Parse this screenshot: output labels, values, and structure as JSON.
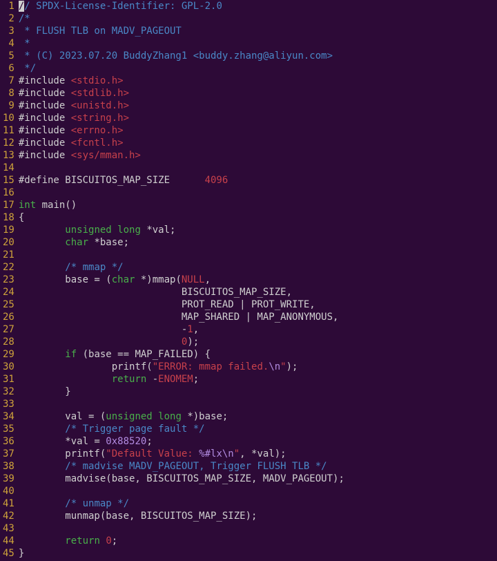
{
  "filename": "main.c",
  "language": "c",
  "lines": [
    {
      "n": 1,
      "tokens": [
        {
          "t": "cursor",
          "v": "/"
        },
        {
          "t": "comment",
          "v": "/ SPDX-License-Identifier: GPL-2.0"
        }
      ]
    },
    {
      "n": 2,
      "tokens": [
        {
          "t": "comment",
          "v": "/*"
        }
      ]
    },
    {
      "n": 3,
      "tokens": [
        {
          "t": "comment",
          "v": " * FLUSH TLB on MADV_PAGEOUT"
        }
      ]
    },
    {
      "n": 4,
      "tokens": [
        {
          "t": "comment",
          "v": " *"
        }
      ]
    },
    {
      "n": 5,
      "tokens": [
        {
          "t": "comment",
          "v": " * (C) 2023.07.20 BuddyZhang1 <buddy.zhang@aliyun.com>"
        }
      ]
    },
    {
      "n": 6,
      "tokens": [
        {
          "t": "comment",
          "v": " */"
        }
      ]
    },
    {
      "n": 7,
      "tokens": [
        {
          "t": "preproc",
          "v": "#include "
        },
        {
          "t": "incfile",
          "v": "<stdio.h>"
        }
      ]
    },
    {
      "n": 8,
      "tokens": [
        {
          "t": "preproc",
          "v": "#include "
        },
        {
          "t": "incfile",
          "v": "<stdlib.h>"
        }
      ]
    },
    {
      "n": 9,
      "tokens": [
        {
          "t": "preproc",
          "v": "#include "
        },
        {
          "t": "incfile",
          "v": "<unistd.h>"
        }
      ]
    },
    {
      "n": 10,
      "tokens": [
        {
          "t": "preproc",
          "v": "#include "
        },
        {
          "t": "incfile",
          "v": "<string.h>"
        }
      ]
    },
    {
      "n": 11,
      "tokens": [
        {
          "t": "preproc",
          "v": "#include "
        },
        {
          "t": "incfile",
          "v": "<errno.h>"
        }
      ]
    },
    {
      "n": 12,
      "tokens": [
        {
          "t": "preproc",
          "v": "#include "
        },
        {
          "t": "incfile",
          "v": "<fcntl.h>"
        }
      ]
    },
    {
      "n": 13,
      "tokens": [
        {
          "t": "preproc",
          "v": "#include "
        },
        {
          "t": "incfile",
          "v": "<sys/mman.h>"
        }
      ]
    },
    {
      "n": 14,
      "tokens": []
    },
    {
      "n": 15,
      "tokens": [
        {
          "t": "preproc",
          "v": "#define BISCUITOS_MAP_SIZE      "
        },
        {
          "t": "number",
          "v": "4096"
        }
      ]
    },
    {
      "n": 16,
      "tokens": []
    },
    {
      "n": 17,
      "tokens": [
        {
          "t": "type",
          "v": "int"
        },
        {
          "t": "ident",
          "v": " main()"
        }
      ]
    },
    {
      "n": 18,
      "tokens": [
        {
          "t": "punct",
          "v": "{"
        }
      ]
    },
    {
      "n": 19,
      "tokens": [
        {
          "t": "ident",
          "v": "        "
        },
        {
          "t": "type",
          "v": "unsigned"
        },
        {
          "t": "ident",
          "v": " "
        },
        {
          "t": "type",
          "v": "long"
        },
        {
          "t": "ident",
          "v": " *val;"
        }
      ]
    },
    {
      "n": 20,
      "tokens": [
        {
          "t": "ident",
          "v": "        "
        },
        {
          "t": "type",
          "v": "char"
        },
        {
          "t": "ident",
          "v": " *base;"
        }
      ]
    },
    {
      "n": 21,
      "tokens": []
    },
    {
      "n": 22,
      "tokens": [
        {
          "t": "ident",
          "v": "        "
        },
        {
          "t": "comment",
          "v": "/* mmap */"
        }
      ]
    },
    {
      "n": 23,
      "tokens": [
        {
          "t": "ident",
          "v": "        base = ("
        },
        {
          "t": "type",
          "v": "char"
        },
        {
          "t": "ident",
          "v": " *)mmap("
        },
        {
          "t": "const",
          "v": "NULL"
        },
        {
          "t": "ident",
          "v": ","
        }
      ]
    },
    {
      "n": 24,
      "tokens": [
        {
          "t": "ident",
          "v": "                            BISCUITOS_MAP_SIZE,"
        }
      ]
    },
    {
      "n": 25,
      "tokens": [
        {
          "t": "ident",
          "v": "                            PROT_READ | PROT_WRITE,"
        }
      ]
    },
    {
      "n": 26,
      "tokens": [
        {
          "t": "ident",
          "v": "                            MAP_SHARED | MAP_ANONYMOUS,"
        }
      ]
    },
    {
      "n": 27,
      "tokens": [
        {
          "t": "ident",
          "v": "                            -"
        },
        {
          "t": "number",
          "v": "1"
        },
        {
          "t": "ident",
          "v": ","
        }
      ]
    },
    {
      "n": 28,
      "tokens": [
        {
          "t": "ident",
          "v": "                            "
        },
        {
          "t": "number",
          "v": "0"
        },
        {
          "t": "ident",
          "v": ");"
        }
      ]
    },
    {
      "n": 29,
      "tokens": [
        {
          "t": "ident",
          "v": "        "
        },
        {
          "t": "keyword",
          "v": "if"
        },
        {
          "t": "ident",
          "v": " (base == MAP_FAILED) {"
        }
      ]
    },
    {
      "n": 30,
      "tokens": [
        {
          "t": "ident",
          "v": "                printf("
        },
        {
          "t": "string",
          "v": "\"ERROR: mmap failed."
        },
        {
          "t": "fmt",
          "v": "\\n"
        },
        {
          "t": "string",
          "v": "\""
        },
        {
          "t": "ident",
          "v": ");"
        }
      ]
    },
    {
      "n": 31,
      "tokens": [
        {
          "t": "ident",
          "v": "                "
        },
        {
          "t": "keyword",
          "v": "return"
        },
        {
          "t": "ident",
          "v": " -"
        },
        {
          "t": "const",
          "v": "ENOMEM"
        },
        {
          "t": "ident",
          "v": ";"
        }
      ]
    },
    {
      "n": 32,
      "tokens": [
        {
          "t": "ident",
          "v": "        }"
        }
      ]
    },
    {
      "n": 33,
      "tokens": []
    },
    {
      "n": 34,
      "tokens": [
        {
          "t": "ident",
          "v": "        val = ("
        },
        {
          "t": "type",
          "v": "unsigned"
        },
        {
          "t": "ident",
          "v": " "
        },
        {
          "t": "type",
          "v": "long"
        },
        {
          "t": "ident",
          "v": " *)base;"
        }
      ]
    },
    {
      "n": 35,
      "tokens": [
        {
          "t": "ident",
          "v": "        "
        },
        {
          "t": "comment",
          "v": "/* Trigger page fault */"
        }
      ]
    },
    {
      "n": 36,
      "tokens": [
        {
          "t": "ident",
          "v": "        *val = "
        },
        {
          "t": "hex",
          "v": "0x88520"
        },
        {
          "t": "ident",
          "v": ";"
        }
      ]
    },
    {
      "n": 37,
      "tokens": [
        {
          "t": "ident",
          "v": "        printf("
        },
        {
          "t": "string",
          "v": "\"Default Value: "
        },
        {
          "t": "fmt",
          "v": "%#lx"
        },
        {
          "t": "fmt",
          "v": "\\n"
        },
        {
          "t": "string",
          "v": "\""
        },
        {
          "t": "ident",
          "v": ", *val);"
        }
      ]
    },
    {
      "n": 38,
      "tokens": [
        {
          "t": "ident",
          "v": "        "
        },
        {
          "t": "comment",
          "v": "/* madvise MADV_PAGEOUT, Trigger FLUSH TLB */"
        }
      ]
    },
    {
      "n": 39,
      "tokens": [
        {
          "t": "ident",
          "v": "        madvise(base, BISCUITOS_MAP_SIZE, MADV_PAGEOUT);"
        }
      ]
    },
    {
      "n": 40,
      "tokens": []
    },
    {
      "n": 41,
      "tokens": [
        {
          "t": "ident",
          "v": "        "
        },
        {
          "t": "comment",
          "v": "/* unmap */"
        }
      ]
    },
    {
      "n": 42,
      "tokens": [
        {
          "t": "ident",
          "v": "        munmap(base, BISCUITOS_MAP_SIZE);"
        }
      ]
    },
    {
      "n": 43,
      "tokens": []
    },
    {
      "n": 44,
      "tokens": [
        {
          "t": "ident",
          "v": "        "
        },
        {
          "t": "keyword",
          "v": "return"
        },
        {
          "t": "ident",
          "v": " "
        },
        {
          "t": "number",
          "v": "0"
        },
        {
          "t": "ident",
          "v": ";"
        }
      ]
    },
    {
      "n": 45,
      "tokens": [
        {
          "t": "punct",
          "v": "}"
        }
      ]
    }
  ]
}
